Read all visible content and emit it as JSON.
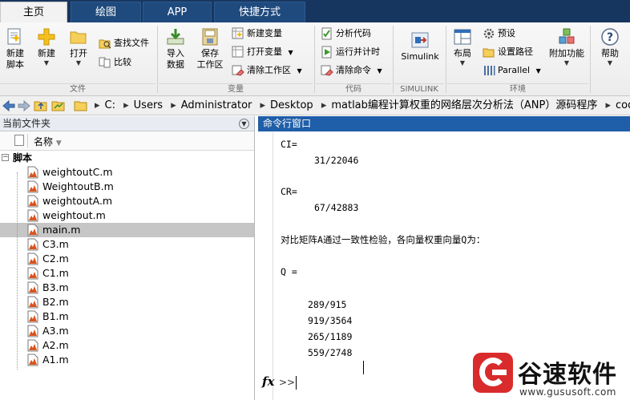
{
  "tabs": [
    {
      "label": "主页"
    },
    {
      "label": "绘图"
    },
    {
      "label": "APP"
    },
    {
      "label": "快捷方式"
    }
  ],
  "ribbon": {
    "file_group": {
      "label": "文件",
      "new_script": "新建\n脚本",
      "new_script_l1": "新建",
      "new_script_l2": "脚本",
      "new": "新建",
      "open": "打开",
      "find_files": "查找文件",
      "compare": "比较"
    },
    "variable_group": {
      "label": "变量",
      "import_l1": "导入",
      "import_l2": "数据",
      "save_l1": "保存",
      "save_l2": "工作区",
      "new_var": "新建变量",
      "open_var": "打开变量",
      "clear_ws": "清除工作区"
    },
    "code_group": {
      "label": "代码",
      "analyze": "分析代码",
      "run_time": "运行并计时",
      "clear_cmd": "清除命令"
    },
    "simulink_group": {
      "label": "SIMULINK",
      "simulink": "Simulink"
    },
    "env_group": {
      "label": "环境",
      "layout": "布局",
      "preferences": "预设",
      "set_path": "设置路径",
      "parallel": "Parallel",
      "addons": "附加功能"
    },
    "help": "帮助"
  },
  "address": {
    "crumbs": [
      "C:",
      "Users",
      "Administrator",
      "Desktop",
      "matlab编程计算权重的网络层次分析法（ANP）源码程序",
      "code"
    ]
  },
  "current_folder": {
    "title": "当前文件夹",
    "column_name": "名称",
    "folder_label": "脚本",
    "files": [
      "weightoutC.m",
      "WeightoutB.m",
      "weightoutA.m",
      "weightout.m",
      "main.m",
      "C3.m",
      "C2.m",
      "C1.m",
      "B3.m",
      "B2.m",
      "B1.m",
      "A3.m",
      "A2.m",
      "A1.m"
    ],
    "selected": "main.m"
  },
  "command_window": {
    "title": "命令行窗口",
    "lines": [
      "CI=",
      "31/22046",
      "CR=",
      "67/42883",
      "对比矩阵A通过一致性检验，各向量权重向量Q为：",
      "Q =",
      "289/915",
      "919/3564",
      "265/1189",
      "559/2748"
    ],
    "prompt": ">>",
    "fx_label": "fx"
  },
  "watermark": {
    "brand": "谷速软件",
    "url": "www.gususoft.com"
  },
  "colors": {
    "tabbar": "#17365f",
    "cmd_title": "#1f5ea8",
    "selected_row": "#c6c6c6",
    "watermark_red": "#d92b2b"
  }
}
